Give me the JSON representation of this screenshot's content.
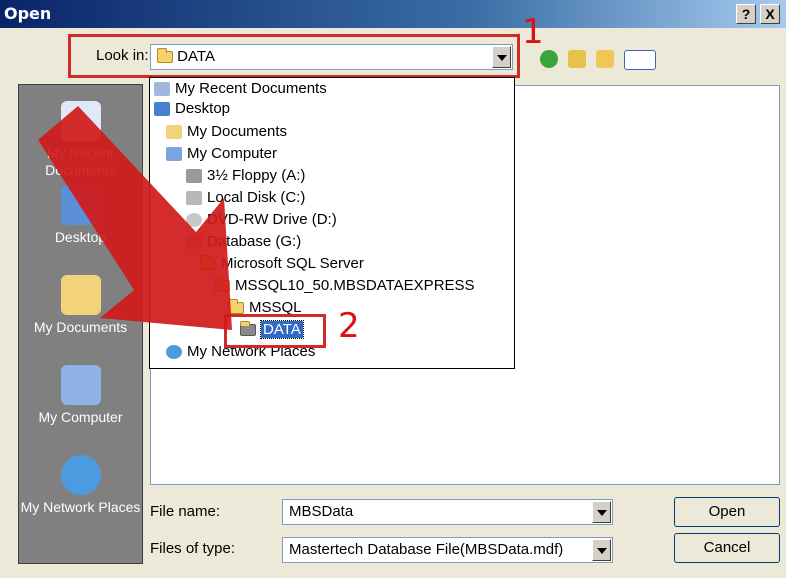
{
  "window": {
    "title": "Open",
    "help_button": "?",
    "close_button": "X"
  },
  "lookin": {
    "label": "Look in:",
    "value": "DATA"
  },
  "toolbar": {
    "icons": [
      "back-icon",
      "up-folder-icon",
      "new-folder-icon",
      "views-menu-icon"
    ]
  },
  "places": [
    {
      "label": "My Recent Documents",
      "icon": "recent-documents-icon"
    },
    {
      "label": "Desktop",
      "icon": "desktop-icon"
    },
    {
      "label": "My Documents",
      "icon": "my-documents-icon"
    },
    {
      "label": "My Computer",
      "icon": "my-computer-icon"
    },
    {
      "label": "My Network Places",
      "icon": "network-places-icon"
    }
  ],
  "dropdown": {
    "items": [
      {
        "label": "My Recent Documents",
        "icon": "recent-documents-icon",
        "level": 0
      },
      {
        "label": "Desktop",
        "icon": "desktop-icon",
        "level": 0
      },
      {
        "label": "My Documents",
        "icon": "my-documents-icon",
        "level": 1
      },
      {
        "label": "My Computer",
        "icon": "my-computer-icon",
        "level": 1
      },
      {
        "label": "3½ Floppy (A:)",
        "icon": "floppy-drive-icon",
        "level": 2
      },
      {
        "label": "Local Disk (C:)",
        "icon": "hard-disk-icon",
        "level": 2
      },
      {
        "label": "DVD-RW Drive (D:)",
        "icon": "dvd-drive-icon",
        "level": 2
      },
      {
        "label": "Database (G:)",
        "icon": "hard-disk-icon",
        "level": 2
      },
      {
        "label": "Microsoft SQL Server",
        "icon": "folder-icon",
        "level": 3
      },
      {
        "label": "MSSQL10_50.MBSDATAEXPRESS",
        "icon": "folder-icon",
        "level": 4
      },
      {
        "label": "MSSQL",
        "icon": "folder-icon",
        "level": 5
      },
      {
        "label": "DATA",
        "icon": "folder-open-icon",
        "level": 6,
        "selected": true
      },
      {
        "label": "My Network Places",
        "icon": "network-places-icon",
        "level": 0
      }
    ]
  },
  "annotations": {
    "step1": "1",
    "step2": "2",
    "color": "#d22a2a"
  },
  "filename": {
    "label": "File name:",
    "value": "MBSData"
  },
  "filetype": {
    "label": "Files of type:",
    "value": "Mastertech Database File(MBSData.mdf)"
  },
  "buttons": {
    "open": "Open",
    "cancel": "Cancel"
  }
}
